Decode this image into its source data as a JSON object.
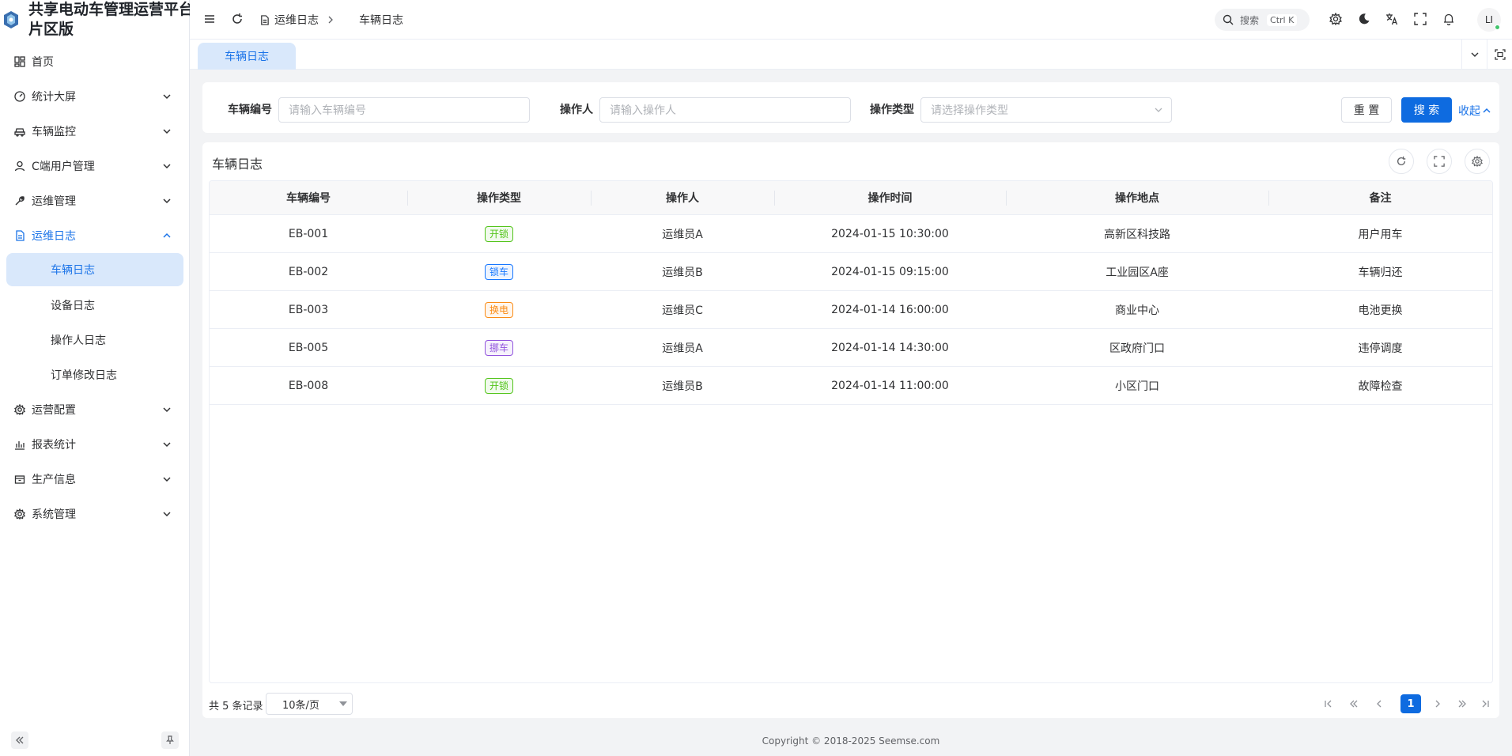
{
  "app": {
    "title_line1": "共享电动车管理运营平台",
    "title_line2": "片区版"
  },
  "sidebar": {
    "items": [
      {
        "label": "首页",
        "icon": "dashboard-icon",
        "has_children": false
      },
      {
        "label": "统计大屏",
        "icon": "gauge-icon",
        "has_children": true
      },
      {
        "label": "车辆监控",
        "icon": "car-icon",
        "has_children": true
      },
      {
        "label": "C端用户管理",
        "icon": "user-icon",
        "has_children": true
      },
      {
        "label": "运维管理",
        "icon": "wrench-icon",
        "has_children": true
      },
      {
        "label": "运维日志",
        "icon": "document-icon",
        "has_children": true,
        "expanded": true
      },
      {
        "label": "运营配置",
        "icon": "gear-icon",
        "has_children": true
      },
      {
        "label": "报表统计",
        "icon": "bar-chart-icon",
        "has_children": true
      },
      {
        "label": "生产信息",
        "icon": "box-icon",
        "has_children": true
      },
      {
        "label": "系统管理",
        "icon": "gear-icon",
        "has_children": true
      }
    ],
    "subitems": [
      {
        "label": "车辆日志",
        "active": true
      },
      {
        "label": "设备日志"
      },
      {
        "label": "操作人日志"
      },
      {
        "label": "订单修改日志"
      }
    ]
  },
  "header": {
    "breadcrumb": [
      "运维日志",
      "车辆日志"
    ],
    "search_label": "搜索",
    "search_shortcut": "Ctrl K",
    "avatar_text": "LI"
  },
  "tabs": [
    {
      "label": "车辆日志",
      "active": true
    }
  ],
  "filters": {
    "vehicle_no": {
      "label": "车辆编号",
      "placeholder": "请输入车辆编号"
    },
    "operator": {
      "label": "操作人",
      "placeholder": "请输入操作人"
    },
    "op_type": {
      "label": "操作类型",
      "placeholder": "请选择操作类型"
    },
    "reset_label": "重 置",
    "search_label": "搜 索",
    "collapse_label": "收起"
  },
  "table": {
    "title": "车辆日志",
    "columns": [
      "车辆编号",
      "操作类型",
      "操作人",
      "操作时间",
      "操作地点",
      "备注"
    ],
    "rows": [
      {
        "vehicle": "EB-001",
        "type": "开锁",
        "type_color": "#52c41a",
        "operator": "运维员A",
        "time": "2024-01-15 10:30:00",
        "location": "高新区科技路",
        "remark": "用户用车"
      },
      {
        "vehicle": "EB-002",
        "type": "锁车",
        "type_color": "#1677ff",
        "operator": "运维员B",
        "time": "2024-01-15 09:15:00",
        "location": "工业园区A座",
        "remark": "车辆归还"
      },
      {
        "vehicle": "EB-003",
        "type": "换电",
        "type_color": "#fa8c16",
        "operator": "运维员C",
        "time": "2024-01-14 16:00:00",
        "location": "商业中心",
        "remark": "电池更换"
      },
      {
        "vehicle": "EB-005",
        "type": "挪车",
        "type_color": "#9254de",
        "operator": "运维员A",
        "time": "2024-01-14 14:30:00",
        "location": "区政府门口",
        "remark": "违停调度"
      },
      {
        "vehicle": "EB-008",
        "type": "开锁",
        "type_color": "#52c41a",
        "operator": "运维员B",
        "time": "2024-01-14 11:00:00",
        "location": "小区门口",
        "remark": "故障检查"
      }
    ]
  },
  "pagination": {
    "total_text": "共 5 条记录",
    "page_size": "10条/页",
    "current_page": "1"
  },
  "footer": {
    "copyright": "Copyright © 2018-2025 Seemse.com"
  },
  "colors": {
    "primary": "#0e6be0",
    "active_bg": "#d9e8fb"
  }
}
